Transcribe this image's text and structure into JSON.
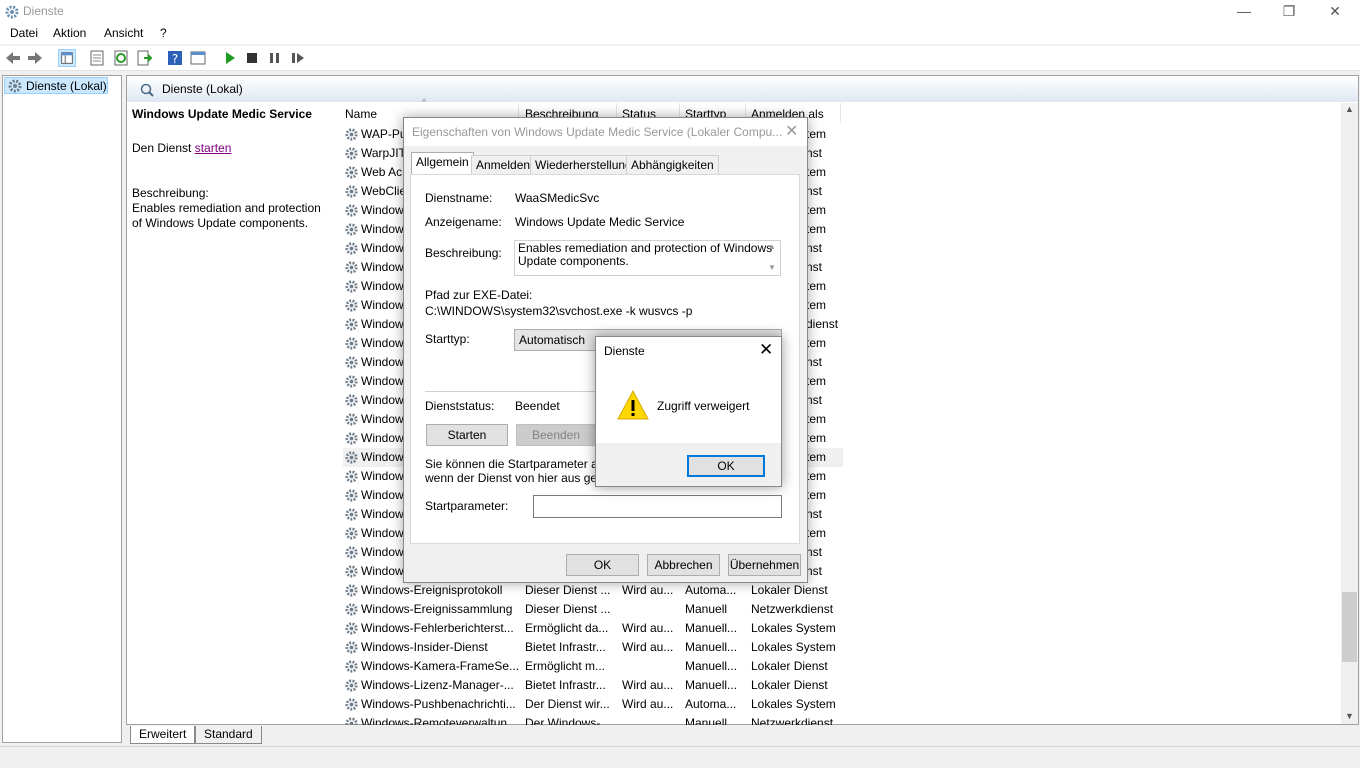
{
  "window": {
    "title": "Dienste",
    "controls": {
      "minimize": "—",
      "restore": "❐",
      "close": "✕"
    }
  },
  "menu": [
    "Datei",
    "Aktion",
    "Ansicht",
    "?"
  ],
  "tree": {
    "item": "Dienste (Lokal)"
  },
  "pane_header": "Dienste (Lokal)",
  "detail": {
    "title": "Windows Update Medic Service",
    "start_prefix": "Den Dienst ",
    "start_link": "starten",
    "desc_label": "Beschreibung:",
    "desc": "Enables remediation and protection of Windows Update components."
  },
  "columns": [
    "Name",
    "Beschreibung",
    "Status",
    "Starttyp",
    "Anmelden als"
  ],
  "rows": [
    {
      "c1": "WAP-Pu",
      "c5": "tem"
    },
    {
      "c1": "WarpJIT",
      "c5": "nst"
    },
    {
      "c1": "Web Ac",
      "c5": "tem"
    },
    {
      "c1": "WebClie",
      "c5": "nst"
    },
    {
      "c1": "Window",
      "c5": "tem"
    },
    {
      "c1": "Window",
      "c5": "tem"
    },
    {
      "c1": "Window",
      "c5": "nst"
    },
    {
      "c1": "Window",
      "c5": "nst"
    },
    {
      "c1": "Window",
      "c5": "tem"
    },
    {
      "c1": "Window",
      "c5": "tem"
    },
    {
      "c1": "Window",
      "c5": "dienst"
    },
    {
      "c1": "Window",
      "c5": "tem"
    },
    {
      "c1": "Window",
      "c5": "nst"
    },
    {
      "c1": "Window",
      "c5": "tem"
    },
    {
      "c1": "Window",
      "c5": "nst"
    },
    {
      "c1": "Window",
      "c5": "tem"
    },
    {
      "c1": "Window",
      "c5": "tem"
    },
    {
      "c1": "Window",
      "c5": "tem"
    },
    {
      "c1": "Window",
      "c5": "tem"
    },
    {
      "c1": "Window",
      "c5": "tem"
    },
    {
      "c1": "Window",
      "c5": "nst"
    },
    {
      "c1": "Window",
      "c5": "tem"
    },
    {
      "c1": "Window",
      "c5": "nst"
    },
    {
      "c1": "Window",
      "c5": "nst"
    },
    {
      "c1": "Windows-Ereignisprotokoll",
      "c2": "Dieser Dienst ...",
      "c3": "Wird au...",
      "c4": "Automa...",
      "c5": "Lokaler Dienst"
    },
    {
      "c1": "Windows-Ereignissammlung",
      "c2": "Dieser Dienst ...",
      "c3": "",
      "c4": "Manuell",
      "c5": "Netzwerkdienst"
    },
    {
      "c1": "Windows-Fehlerberichterst...",
      "c2": "Ermöglicht da...",
      "c3": "Wird au...",
      "c4": "Manuell...",
      "c5": "Lokales System"
    },
    {
      "c1": "Windows-Insider-Dienst",
      "c2": "Bietet Infrastr...",
      "c3": "Wird au...",
      "c4": "Manuell...",
      "c5": "Lokales System"
    },
    {
      "c1": "Windows-Kamera-FrameSe...",
      "c2": "Ermöglicht m...",
      "c3": "",
      "c4": "Manuell...",
      "c5": "Lokaler Dienst"
    },
    {
      "c1": "Windows-Lizenz-Manager-...",
      "c2": "Bietet Infrastr...",
      "c3": "Wird au...",
      "c4": "Manuell...",
      "c5": "Lokaler Dienst"
    },
    {
      "c1": "Windows-Pushbenachrichti...",
      "c2": "Der Dienst wir...",
      "c3": "Wird au...",
      "c4": "Automa...",
      "c5": "Lokales System"
    },
    {
      "c1": "Windows-Remoteverwaltun...",
      "c2": "Der Windows-...",
      "c3": "",
      "c4": "Manuell",
      "c5": "Netzwerkdienst"
    }
  ],
  "bottom_tabs": [
    "Erweitert",
    "Standard"
  ],
  "props": {
    "title": "Eigenschaften von Windows Update Medic Service (Lokaler Compu...",
    "tabs": [
      "Allgemein",
      "Anmelden",
      "Wiederherstellung",
      "Abhängigkeiten"
    ],
    "service_name_label": "Dienstname:",
    "service_name": "WaaSMedicSvc",
    "display_name_label": "Anzeigename:",
    "display_name": "Windows Update Medic Service",
    "desc_label": "Beschreibung:",
    "desc": "Enables remediation and protection of Windows Update components.",
    "path_label": "Pfad zur EXE-Datei:",
    "path": "C:\\WINDOWS\\system32\\svchost.exe -k wusvcs -p",
    "start_type_label": "Starttyp:",
    "start_type": "Automatisch",
    "status_label": "Dienststatus:",
    "status": "Beendet",
    "btn_start": "Starten",
    "btn_stop": "Beenden",
    "hint_line1": "Sie können die Startparameter ange",
    "hint_line2": "wenn der Dienst von hier aus gestar",
    "param_label": "Startparameter:",
    "ok": "OK",
    "cancel": "Abbrechen",
    "apply": "Übernehmen"
  },
  "alert": {
    "title": "Dienste",
    "message": "Zugriff verweigert",
    "ok": "OK"
  }
}
